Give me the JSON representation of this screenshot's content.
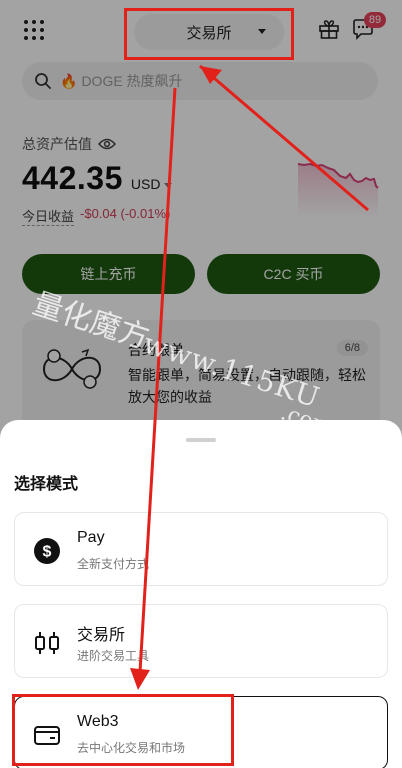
{
  "header": {
    "mode_label": "交易所",
    "notification_count": "89"
  },
  "search": {
    "placeholder": "DOGE 热度飙升"
  },
  "assets": {
    "title": "总资产估值",
    "amount": "442.35",
    "currency": "USD",
    "pnl_label": "今日收益",
    "pnl_value": "-$0.04 (-0.01%)"
  },
  "actions": {
    "deposit_label": "链上充币",
    "c2c_label": "C2C 买币"
  },
  "promo": {
    "title": "合约跟单",
    "description": "智能跟单，简易设置，自动跟随，轻松放大您的收益",
    "pager": "6/8"
  },
  "sheet": {
    "title": "选择模式",
    "options": [
      {
        "name": "Pay",
        "subtitle": "全新支付方式"
      },
      {
        "name": "交易所",
        "subtitle": "进阶交易工具"
      },
      {
        "name": "Web3",
        "subtitle": "去中心化交易和市场"
      }
    ]
  },
  "watermark": {
    "line1": "量化魔方",
    "line2": "www.115KU",
    "line3": ".com"
  },
  "colors": {
    "primary_green": "#1f5a12",
    "negative_red": "#d23c55",
    "badge_red": "#e8435a",
    "annotation_red": "#e3211b"
  }
}
